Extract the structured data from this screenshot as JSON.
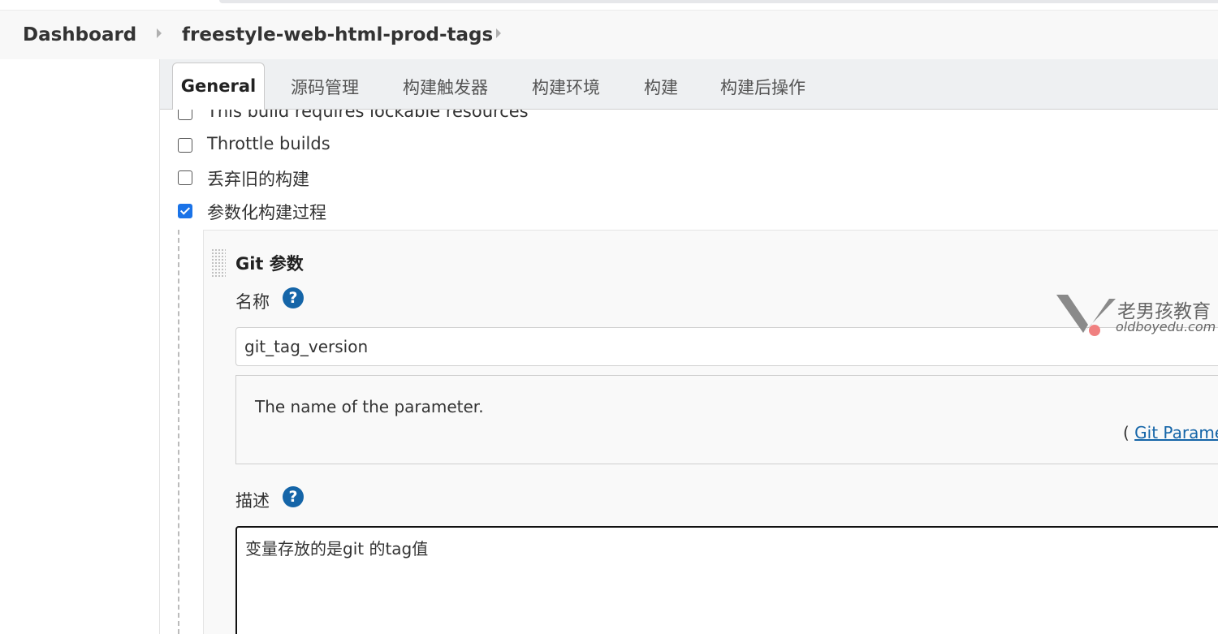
{
  "breadcrumb": {
    "dashboard": "Dashboard",
    "job": "freestyle-web-html-prod-tags"
  },
  "tabs": [
    "General",
    "源码管理",
    "构建触发器",
    "构建环境",
    "构建",
    "构建后操作"
  ],
  "options": [
    {
      "label": "This build requires lockable resources",
      "checked": false
    },
    {
      "label": "Throttle builds",
      "checked": false
    },
    {
      "label": "丢弃旧的构建",
      "checked": false
    },
    {
      "label": "参数化构建过程",
      "checked": true
    }
  ],
  "parameter": {
    "title": "Git 参数",
    "name_label": "名称",
    "name_value": "git_tag_version",
    "name_help": "The name of the parameter.",
    "plugin_link_prefix": "( ",
    "plugin_link": "Git Parame",
    "description_label": "描述",
    "description_value": "变量存放的是git 的tag值"
  },
  "watermark": {
    "cn": "老男孩教育",
    "en": "oldboyedu.com"
  },
  "colors": {
    "accent": "#1565a8",
    "checkbox_checked": "#1a73e8"
  }
}
